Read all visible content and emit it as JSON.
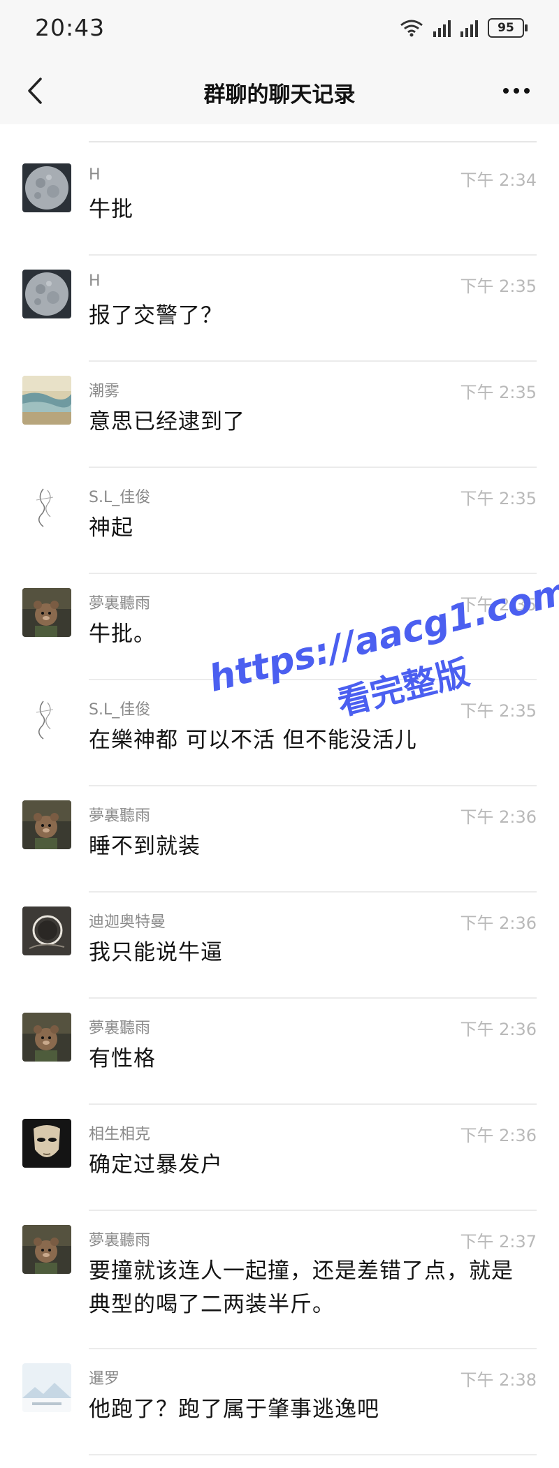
{
  "status": {
    "time": "20:43",
    "battery": "95"
  },
  "nav": {
    "title": "群聊的聊天记录"
  },
  "messages": [
    {
      "name": "H",
      "time": "下午 2:34",
      "text": "牛批",
      "avatar": "moon"
    },
    {
      "name": "H",
      "time": "下午 2:35",
      "text": "报了交警了？",
      "avatar": "moon"
    },
    {
      "name": "潮雾",
      "time": "下午 2:35",
      "text": "意思已经逮到了",
      "avatar": "landscape"
    },
    {
      "name": "S.L_佳俊",
      "time": "下午 2:35",
      "text": "神起",
      "avatar": "sketch"
    },
    {
      "name": "夢裏聽雨",
      "time": "下午 2:35",
      "text": "牛批。",
      "avatar": "bear"
    },
    {
      "name": "S.L_佳俊",
      "time": "下午 2:35",
      "text": "在樂神都 可以不活 但不能没活儿",
      "avatar": "sketch"
    },
    {
      "name": "夢裏聽雨",
      "time": "下午 2:36",
      "text": "睡不到就装",
      "avatar": "bear"
    },
    {
      "name": "迪迦奥特曼",
      "time": "下午 2:36",
      "text": "我只能说牛逼",
      "avatar": "ring"
    },
    {
      "name": "夢裏聽雨",
      "time": "下午 2:36",
      "text": "有性格",
      "avatar": "bear"
    },
    {
      "name": "相生相克",
      "time": "下午 2:36",
      "text": "确定过暴发户",
      "avatar": "mask"
    },
    {
      "name": "夢裏聽雨",
      "time": "下午 2:37",
      "text": "要撞就该连人一起撞，还是差错了点，就是典型的喝了二两装半斤。",
      "avatar": "bear"
    },
    {
      "name": "暹罗",
      "time": "下午 2:38",
      "text": "他跑了？跑了属于肇事逃逸吧",
      "avatar": "mountain"
    }
  ],
  "watermark": {
    "line1": "https://aacg1.com",
    "line2": "看完整版"
  }
}
